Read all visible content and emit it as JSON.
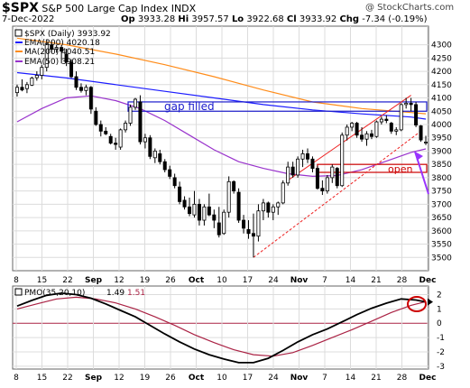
{
  "header": {
    "symbol": "$SPX",
    "name": "S&P 500 Large Cap Index",
    "exchange": "INDX",
    "copyright": "@ StockCharts.com",
    "date": "7-Dec-2022",
    "op_label": "Op",
    "op": "3933.28",
    "hi_label": "Hi",
    "hi": "3957.57",
    "lo_label": "Lo",
    "lo": "3922.68",
    "cl_label": "Cl",
    "cl": "3933.92",
    "chg_label": "Chg",
    "chg": "-7.34 (-0.19%)"
  },
  "legend": {
    "spx": "$SPX (Daily) 3933.92",
    "ema200": "EMA(200) 4020.18",
    "ma200": "MA(200) 4040.51",
    "ema50": "EMA(50) 3908.21"
  },
  "annotations": {
    "gap": "gap filled",
    "open": "open"
  },
  "pmo": {
    "label": "PMO(35,20,10)",
    "value1": "1.49",
    "value2": "1.51"
  },
  "colors": {
    "up": "#ffffff",
    "down": "#000000",
    "ema200": "#1c1cff",
    "ma200": "#ff8c1a",
    "ema50": "#9933cc",
    "pmo": "#000000",
    "pmo_signal": "#aa2244",
    "annotation": "#1c1ccc",
    "arrow": "#9933ff",
    "highlight": "#cc0000"
  },
  "x_ticks": [
    "8",
    "15",
    "22",
    "Sep",
    "12",
    "19",
    "26",
    "Oct",
    "10",
    "17",
    "24",
    "Nov",
    "7",
    "14",
    "21",
    "28",
    "Dec"
  ],
  "chart_data": [
    {
      "type": "candlestick",
      "title": "$SPX (Daily)",
      "ylim": [
        3450,
        4370
      ],
      "y_ticks": [
        3500,
        3550,
        3600,
        3650,
        3700,
        3750,
        3800,
        3850,
        3900,
        3950,
        4000,
        4050,
        4100,
        4150,
        4200,
        4250,
        4300
      ],
      "candles": [
        {
          "o": 4120,
          "h": 4150,
          "l": 4105,
          "c": 4140
        },
        {
          "o": 4140,
          "h": 4170,
          "l": 4125,
          "c": 4130
        },
        {
          "o": 4135,
          "h": 4160,
          "l": 4118,
          "c": 4150
        },
        {
          "o": 4148,
          "h": 4180,
          "l": 4145,
          "c": 4175
        },
        {
          "o": 4176,
          "h": 4200,
          "l": 4165,
          "c": 4185
        },
        {
          "o": 4185,
          "h": 4225,
          "l": 4170,
          "c": 4215
        },
        {
          "o": 4215,
          "h": 4320,
          "l": 4200,
          "c": 4305
        },
        {
          "o": 4300,
          "h": 4315,
          "l": 4270,
          "c": 4283
        },
        {
          "o": 4283,
          "h": 4300,
          "l": 4270,
          "c": 4290
        },
        {
          "o": 4290,
          "h": 4298,
          "l": 4230,
          "c": 4276
        },
        {
          "o": 4265,
          "h": 4285,
          "l": 4220,
          "c": 4235
        },
        {
          "o": 4235,
          "h": 4245,
          "l": 4175,
          "c": 4180
        },
        {
          "o": 4180,
          "h": 4200,
          "l": 4130,
          "c": 4140
        },
        {
          "o": 4140,
          "h": 4155,
          "l": 4120,
          "c": 4128
        },
        {
          "o": 4128,
          "h": 4150,
          "l": 4110,
          "c": 4140
        },
        {
          "o": 4140,
          "h": 4145,
          "l": 4040,
          "c": 4058
        },
        {
          "o": 4050,
          "h": 4065,
          "l": 3995,
          "c": 4000
        },
        {
          "o": 4000,
          "h": 4015,
          "l": 3955,
          "c": 3975
        },
        {
          "o": 3975,
          "h": 3990,
          "l": 3960,
          "c": 3965
        },
        {
          "o": 3955,
          "h": 3965,
          "l": 3925,
          "c": 3930
        },
        {
          "o": 3930,
          "h": 3950,
          "l": 3905,
          "c": 3925
        },
        {
          "o": 3915,
          "h": 3985,
          "l": 3905,
          "c": 3980
        },
        {
          "o": 3980,
          "h": 4015,
          "l": 3970,
          "c": 4005
        },
        {
          "o": 4005,
          "h": 4075,
          "l": 3995,
          "c": 4065
        },
        {
          "o": 4065,
          "h": 4100,
          "l": 4055,
          "c": 4095
        },
        {
          "o": 4085,
          "h": 4110,
          "l": 3925,
          "c": 3935
        },
        {
          "o": 3935,
          "h": 3965,
          "l": 3910,
          "c": 3950
        },
        {
          "o": 3950,
          "h": 3960,
          "l": 3870,
          "c": 3880
        },
        {
          "o": 3875,
          "h": 3910,
          "l": 3855,
          "c": 3900
        },
        {
          "o": 3890,
          "h": 3905,
          "l": 3850,
          "c": 3860
        },
        {
          "o": 3860,
          "h": 3870,
          "l": 3820,
          "c": 3830
        },
        {
          "o": 3830,
          "h": 3845,
          "l": 3795,
          "c": 3805
        },
        {
          "o": 3800,
          "h": 3815,
          "l": 3760,
          "c": 3770
        },
        {
          "o": 3765,
          "h": 3785,
          "l": 3700,
          "c": 3710
        },
        {
          "o": 3715,
          "h": 3730,
          "l": 3680,
          "c": 3690
        },
        {
          "o": 3690,
          "h": 3725,
          "l": 3655,
          "c": 3665
        },
        {
          "o": 3660,
          "h": 3750,
          "l": 3650,
          "c": 3700
        },
        {
          "o": 3700,
          "h": 3720,
          "l": 3620,
          "c": 3640
        },
        {
          "o": 3640,
          "h": 3700,
          "l": 3620,
          "c": 3690
        },
        {
          "o": 3690,
          "h": 3740,
          "l": 3655,
          "c": 3660
        },
        {
          "o": 3660,
          "h": 3680,
          "l": 3610,
          "c": 3640
        },
        {
          "o": 3630,
          "h": 3690,
          "l": 3575,
          "c": 3585
        },
        {
          "o": 3590,
          "h": 3680,
          "l": 3585,
          "c": 3670
        },
        {
          "o": 3670,
          "h": 3805,
          "l": 3650,
          "c": 3785
        },
        {
          "o": 3785,
          "h": 3790,
          "l": 3740,
          "c": 3750
        },
        {
          "o": 3745,
          "h": 3760,
          "l": 3630,
          "c": 3640
        },
        {
          "o": 3640,
          "h": 3660,
          "l": 3590,
          "c": 3610
        },
        {
          "o": 3605,
          "h": 3640,
          "l": 3570,
          "c": 3590
        },
        {
          "o": 3590,
          "h": 3665,
          "l": 3500,
          "c": 3580
        },
        {
          "o": 3580,
          "h": 3700,
          "l": 3560,
          "c": 3675
        },
        {
          "o": 3675,
          "h": 3720,
          "l": 3640,
          "c": 3705
        },
        {
          "o": 3705,
          "h": 3710,
          "l": 3650,
          "c": 3670
        },
        {
          "o": 3670,
          "h": 3700,
          "l": 3640,
          "c": 3690
        },
        {
          "o": 3690,
          "h": 3710,
          "l": 3660,
          "c": 3705
        },
        {
          "o": 3705,
          "h": 3790,
          "l": 3700,
          "c": 3780
        },
        {
          "o": 3780,
          "h": 3860,
          "l": 3770,
          "c": 3840
        },
        {
          "o": 3840,
          "h": 3860,
          "l": 3800,
          "c": 3810
        },
        {
          "o": 3810,
          "h": 3880,
          "l": 3800,
          "c": 3870
        },
        {
          "o": 3870,
          "h": 3905,
          "l": 3840,
          "c": 3890
        },
        {
          "o": 3890,
          "h": 3910,
          "l": 3855,
          "c": 3870
        },
        {
          "o": 3870,
          "h": 3880,
          "l": 3820,
          "c": 3835
        },
        {
          "o": 3835,
          "h": 3845,
          "l": 3755,
          "c": 3760
        },
        {
          "o": 3760,
          "h": 3790,
          "l": 3735,
          "c": 3750
        },
        {
          "o": 3750,
          "h": 3810,
          "l": 3740,
          "c": 3800
        },
        {
          "o": 3800,
          "h": 3850,
          "l": 3780,
          "c": 3840
        },
        {
          "o": 3835,
          "h": 3840,
          "l": 3760,
          "c": 3770
        },
        {
          "o": 3770,
          "h": 3970,
          "l": 3765,
          "c": 3960
        },
        {
          "o": 3960,
          "h": 4000,
          "l": 3940,
          "c": 3990
        },
        {
          "o": 3990,
          "h": 4010,
          "l": 3975,
          "c": 4005
        },
        {
          "o": 4005,
          "h": 4010,
          "l": 3950,
          "c": 3960
        },
        {
          "o": 3960,
          "h": 3990,
          "l": 3935,
          "c": 3945
        },
        {
          "o": 3945,
          "h": 3975,
          "l": 3920,
          "c": 3965
        },
        {
          "o": 3965,
          "h": 3980,
          "l": 3945,
          "c": 3955
        },
        {
          "o": 3955,
          "h": 4015,
          "l": 3950,
          "c": 4010
        },
        {
          "o": 4010,
          "h": 4030,
          "l": 4000,
          "c": 4020
        },
        {
          "o": 4020,
          "h": 4035,
          "l": 4005,
          "c": 4015
        },
        {
          "o": 4005,
          "h": 4010,
          "l": 3965,
          "c": 3975
        },
        {
          "o": 3975,
          "h": 3990,
          "l": 3960,
          "c": 3980
        },
        {
          "o": 3980,
          "h": 4080,
          "l": 3975,
          "c": 4075
        },
        {
          "o": 4075,
          "h": 4100,
          "l": 4060,
          "c": 4080
        },
        {
          "o": 4080,
          "h": 4100,
          "l": 4050,
          "c": 4075
        },
        {
          "o": 4075,
          "h": 4085,
          "l": 3990,
          "c": 3998
        },
        {
          "o": 3995,
          "h": 3998,
          "l": 3935,
          "c": 3942
        },
        {
          "o": 3933.28,
          "h": 3957.57,
          "l": 3922.68,
          "c": 3933.92
        }
      ],
      "series": [
        {
          "name": "EMA(200)",
          "color": "#1c1cff",
          "values": [
            [
              0,
              4195
            ],
            [
              10,
              4175
            ],
            [
              20,
              4150
            ],
            [
              30,
              4125
            ],
            [
              40,
              4100
            ],
            [
              50,
              4075
            ],
            [
              60,
              4055
            ],
            [
              70,
              4040
            ],
            [
              80,
              4028
            ],
            [
              83,
              4020.18
            ]
          ]
        },
        {
          "name": "MA(200)",
          "color": "#ff8c1a",
          "values": [
            [
              0,
              4325
            ],
            [
              10,
              4300
            ],
            [
              20,
              4265
            ],
            [
              30,
              4225
            ],
            [
              40,
              4180
            ],
            [
              50,
              4130
            ],
            [
              60,
              4085
            ],
            [
              70,
              4060
            ],
            [
              80,
              4045
            ],
            [
              83,
              4040.51
            ]
          ]
        },
        {
          "name": "EMA(50)",
          "color": "#9933cc",
          "values": [
            [
              0,
              4010
            ],
            [
              5,
              4060
            ],
            [
              10,
              4100
            ],
            [
              15,
              4108
            ],
            [
              20,
              4090
            ],
            [
              25,
              4060
            ],
            [
              30,
              4015
            ],
            [
              35,
              3960
            ],
            [
              40,
              3905
            ],
            [
              45,
              3860
            ],
            [
              50,
              3835
            ],
            [
              55,
              3815
            ],
            [
              60,
              3805
            ],
            [
              65,
              3808
            ],
            [
              70,
              3830
            ],
            [
              75,
              3862
            ],
            [
              80,
              3895
            ],
            [
              83,
              3908.21
            ]
          ]
        }
      ],
      "annotations": [
        {
          "type": "rect",
          "label": "gap filled",
          "x": [
            14,
            83
          ],
          "y": [
            4050,
            4085
          ]
        },
        {
          "type": "rect",
          "label": "open",
          "x": [
            61,
            83
          ],
          "y": [
            3820,
            3850
          ]
        },
        {
          "type": "line",
          "style": "solid",
          "color": "#ee2222",
          "x": [
            55,
            80
          ],
          "y": [
            3790,
            4110
          ]
        },
        {
          "type": "line",
          "style": "dashed",
          "color": "#ee2222",
          "x": [
            48,
            82
          ],
          "y": [
            3500,
            3975
          ]
        },
        {
          "type": "arrow",
          "color": "#9933ff",
          "x": [
            83,
            80
          ],
          "y": [
            3710,
            3895
          ]
        }
      ]
    },
    {
      "type": "line",
      "title": "PMO(35,20,10)",
      "ylim": [
        -3.2,
        2.6
      ],
      "y_ticks": [
        -3,
        -2,
        -1,
        0,
        1,
        2
      ],
      "zero_line": 0,
      "series": [
        {
          "name": "PMO(35,20,10)",
          "color": "#000000",
          "values": [
            [
              0,
              1.2
            ],
            [
              3,
              1.6
            ],
            [
              6,
              1.95
            ],
            [
              9,
              2.1
            ],
            [
              12,
              2.0
            ],
            [
              15,
              1.75
            ],
            [
              18,
              1.35
            ],
            [
              21,
              0.9
            ],
            [
              24,
              0.45
            ],
            [
              27,
              -0.15
            ],
            [
              30,
              -0.75
            ],
            [
              33,
              -1.3
            ],
            [
              36,
              -1.8
            ],
            [
              39,
              -2.2
            ],
            [
              42,
              -2.5
            ],
            [
              45,
              -2.75
            ],
            [
              48,
              -2.75
            ],
            [
              51,
              -2.45
            ],
            [
              54,
              -1.9
            ],
            [
              57,
              -1.3
            ],
            [
              60,
              -0.8
            ],
            [
              63,
              -0.4
            ],
            [
              66,
              0.1
            ],
            [
              69,
              0.6
            ],
            [
              72,
              1.05
            ],
            [
              75,
              1.4
            ],
            [
              78,
              1.7
            ],
            [
              81,
              1.62
            ],
            [
              83,
              1.49
            ]
          ]
        },
        {
          "name": "Signal",
          "color": "#aa2244",
          "values": [
            [
              0,
              1.0
            ],
            [
              4,
              1.35
            ],
            [
              8,
              1.7
            ],
            [
              12,
              1.82
            ],
            [
              16,
              1.7
            ],
            [
              20,
              1.42
            ],
            [
              24,
              1.0
            ],
            [
              28,
              0.45
            ],
            [
              32,
              -0.15
            ],
            [
              36,
              -0.8
            ],
            [
              40,
              -1.35
            ],
            [
              44,
              -1.85
            ],
            [
              48,
              -2.2
            ],
            [
              52,
              -2.3
            ],
            [
              56,
              -2.05
            ],
            [
              60,
              -1.55
            ],
            [
              64,
              -1.0
            ],
            [
              68,
              -0.45
            ],
            [
              72,
              0.15
            ],
            [
              76,
              0.75
            ],
            [
              80,
              1.25
            ],
            [
              83,
              1.51
            ]
          ]
        }
      ]
    }
  ]
}
